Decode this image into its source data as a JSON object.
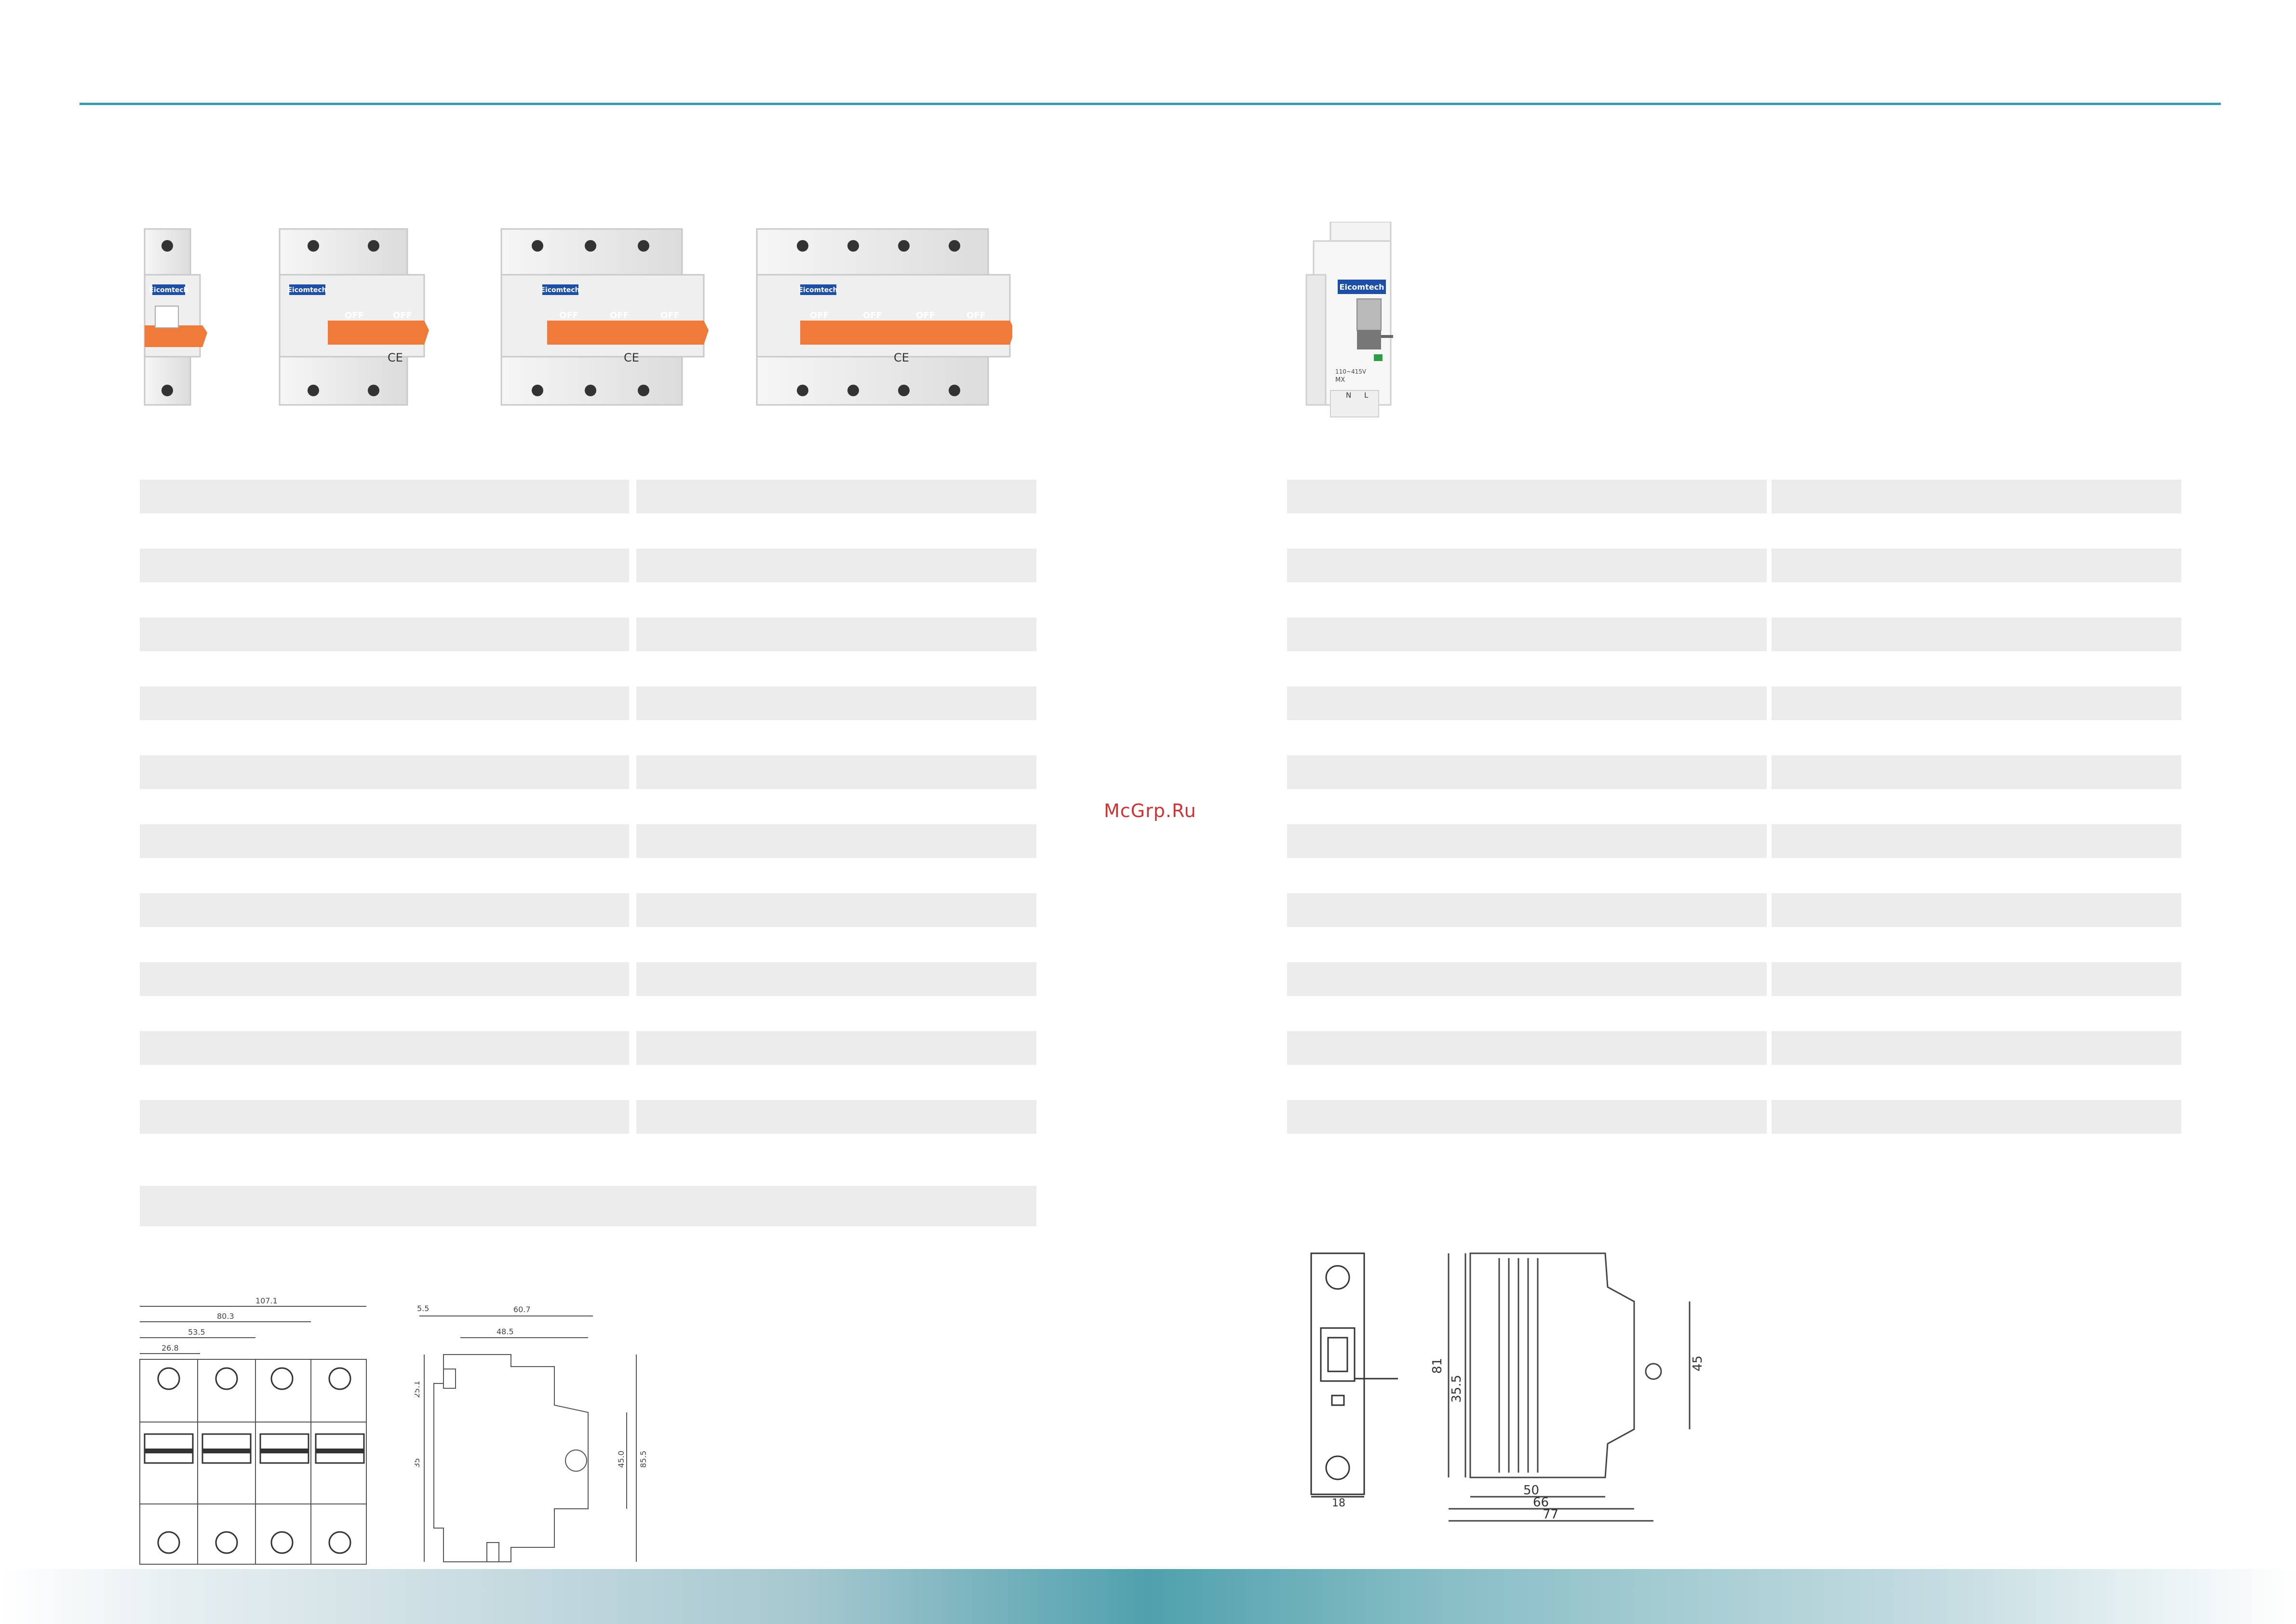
{
  "watermark": "McGrp.Ru",
  "mcb_products": {
    "brand_label": "Eicomtech",
    "handle_label": "OFF",
    "mark": "CE",
    "variants": [
      "1P",
      "2P",
      "3P",
      "4P"
    ]
  },
  "shunt_product": {
    "brand_label": "Eicomtech",
    "print_line1": "110~415V",
    "print_line2": "MX",
    "terminals": [
      "N",
      "L"
    ]
  },
  "mcb_drawing": {
    "dims": [
      "107.1",
      "80.3",
      "53.5",
      "26.8",
      "5.5",
      "60.7",
      "48.5",
      "25.1",
      "35",
      "45.0",
      "85.5"
    ]
  },
  "shunt_drawing": {
    "dims": [
      "81",
      "35.5",
      "45",
      "50",
      "66",
      "77",
      "18"
    ]
  },
  "colors": {
    "accent_line": "#3d9ab4",
    "row_fill": "#ebebeb",
    "handle_orange": "#f07a3a",
    "watermark_red": "#cc3333"
  }
}
